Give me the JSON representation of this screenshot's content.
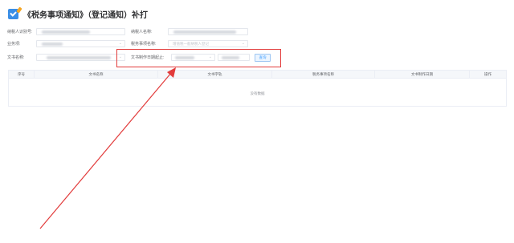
{
  "header": {
    "title": "《税务事项通知》（登记通知）补打"
  },
  "form": {
    "taxpayer_id_label": "纳税人识别号:",
    "taxpayer_name_label": "纳税人名称:",
    "business_label": "业务项:",
    "tax_matter_label": "税务事项名称:",
    "tax_matter_placeholder": "增值税一般纳税人登记",
    "doc_name_label": "文书名称:",
    "doc_date_label": "文书制作日期起止:",
    "query_button": "查询"
  },
  "table": {
    "columns": [
      "序号",
      "文书名称",
      "文书字轨",
      "税务事项名称",
      "文书制作日期",
      "操作"
    ],
    "empty_text": "没有数据"
  },
  "colors": {
    "highlight": "#e23b3b",
    "accent": "#409eff"
  }
}
